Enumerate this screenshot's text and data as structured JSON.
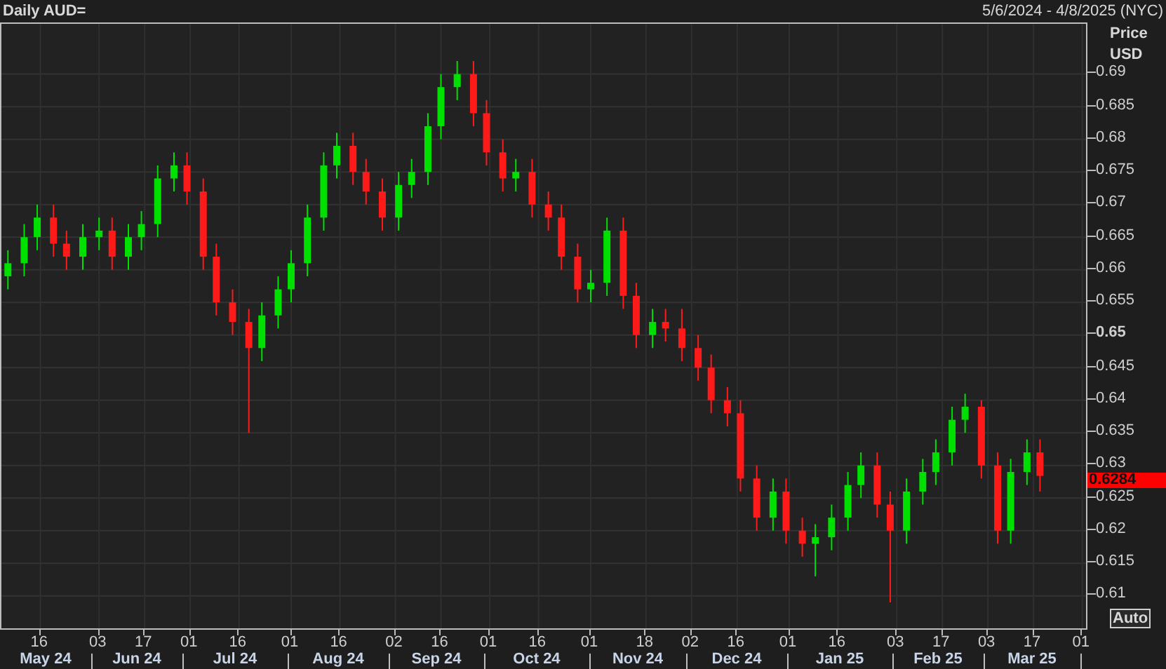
{
  "header": {
    "title": "Daily AUD=",
    "range": "5/6/2024 - 4/8/2025 (NYC)"
  },
  "price_axis": {
    "title": "Price",
    "unit": "USD"
  },
  "last_price": "0.6284",
  "auto_button": "Auto",
  "time_axis": {
    "months": [
      "May 24",
      "Jun 24",
      "Jul 24",
      "Aug 24",
      "Sep 24",
      "Oct 24",
      "Nov 24",
      "Dec 24",
      "Jan 25",
      "Feb 25",
      "Mar 25"
    ]
  },
  "chart": {
    "chart_data": {
      "type": "candlestick",
      "xlim": [
        "2024-05-04",
        "2025-04-03"
      ],
      "ylim": [
        0.6046,
        0.6977
      ],
      "grid": true,
      "x": [
        "2024-05-06",
        "2024-05-11",
        "2024-05-15",
        "2024-05-20",
        "2024-05-24",
        "2024-05-29",
        "2024-06-03",
        "2024-06-07",
        "2024-06-12",
        "2024-06-16",
        "2024-06-21",
        "2024-06-26",
        "2024-06-30",
        "2024-07-05",
        "2024-07-09",
        "2024-07-14",
        "2024-07-19",
        "2024-07-23",
        "2024-07-28",
        "2024-08-01",
        "2024-08-06",
        "2024-08-11",
        "2024-08-15",
        "2024-08-20",
        "2024-08-24",
        "2024-08-29",
        "2024-09-03",
        "2024-09-07",
        "2024-09-12",
        "2024-09-16",
        "2024-09-21",
        "2024-09-26",
        "2024-09-30",
        "2024-10-05",
        "2024-10-09",
        "2024-10-14",
        "2024-10-19",
        "2024-10-23",
        "2024-10-28",
        "2024-11-01",
        "2024-11-06",
        "2024-11-11",
        "2024-11-15",
        "2024-11-20",
        "2024-11-24",
        "2024-11-29",
        "2024-12-04",
        "2024-12-08",
        "2024-12-13",
        "2024-12-17",
        "2024-12-22",
        "2024-12-27",
        "2024-12-31",
        "2025-01-05",
        "2025-01-09",
        "2025-01-14",
        "2025-01-19",
        "2025-01-23",
        "2025-01-28",
        "2025-02-01",
        "2025-02-06",
        "2025-02-11",
        "2025-02-15",
        "2025-02-20",
        "2025-02-24",
        "2025-03-01",
        "2025-03-06",
        "2025-03-10",
        "2025-03-15",
        "2025-03-19"
      ],
      "xticks": [
        {
          "value": "2024-05-16",
          "label": "16"
        },
        {
          "value": "2024-06-03",
          "label": "03"
        },
        {
          "value": "2024-06-17",
          "label": "17"
        },
        {
          "value": "2024-07-01",
          "label": "01"
        },
        {
          "value": "2024-07-16",
          "label": "16"
        },
        {
          "value": "2024-08-01",
          "label": "01"
        },
        {
          "value": "2024-08-16",
          "label": "16"
        },
        {
          "value": "2024-09-02",
          "label": "02"
        },
        {
          "value": "2024-09-16",
          "label": "16"
        },
        {
          "value": "2024-10-01",
          "label": "01"
        },
        {
          "value": "2024-10-16",
          "label": "16"
        },
        {
          "value": "2024-11-01",
          "label": "01"
        },
        {
          "value": "2024-11-18",
          "label": "18"
        },
        {
          "value": "2024-12-02",
          "label": "02"
        },
        {
          "value": "2024-12-16",
          "label": "16"
        },
        {
          "value": "2025-01-01",
          "label": "01"
        },
        {
          "value": "2025-01-16",
          "label": "16"
        },
        {
          "value": "2025-02-03",
          "label": "03"
        },
        {
          "value": "2025-02-17",
          "label": "17"
        },
        {
          "value": "2025-03-03",
          "label": "03"
        },
        {
          "value": "2025-03-17",
          "label": "17"
        },
        {
          "value": "2025-04-01",
          "label": "01"
        }
      ],
      "yticks": [
        {
          "value": 0.69,
          "label": "0.69"
        },
        {
          "value": 0.685,
          "label": "0.685"
        },
        {
          "value": 0.68,
          "label": "0.68"
        },
        {
          "value": 0.675,
          "label": "0.675"
        },
        {
          "value": 0.67,
          "label": "0.67"
        },
        {
          "value": 0.665,
          "label": "0.665"
        },
        {
          "value": 0.66,
          "label": "0.66"
        },
        {
          "value": 0.655,
          "label": "0.655"
        },
        {
          "value": 0.65,
          "label": "0.65"
        },
        {
          "value": 0.645,
          "label": "0.645"
        },
        {
          "value": 0.64,
          "label": "0.64"
        },
        {
          "value": 0.635,
          "label": "0.635"
        },
        {
          "value": 0.63,
          "label": "0.63"
        },
        {
          "value": 0.625,
          "label": "0.625"
        },
        {
          "value": 0.62,
          "label": "0.62"
        },
        {
          "value": 0.615,
          "label": "0.615"
        },
        {
          "value": 0.61,
          "label": "0.61"
        }
      ],
      "ohlc": [
        [
          0.659,
          0.663,
          0.657,
          0.661
        ],
        [
          0.661,
          0.667,
          0.659,
          0.665
        ],
        [
          0.665,
          0.67,
          0.663,
          0.668
        ],
        [
          0.668,
          0.67,
          0.662,
          0.664
        ],
        [
          0.664,
          0.666,
          0.66,
          0.662
        ],
        [
          0.662,
          0.667,
          0.66,
          0.665
        ],
        [
          0.665,
          0.668,
          0.663,
          0.666
        ],
        [
          0.666,
          0.668,
          0.66,
          0.662
        ],
        [
          0.662,
          0.667,
          0.66,
          0.665
        ],
        [
          0.665,
          0.669,
          0.663,
          0.667
        ],
        [
          0.667,
          0.676,
          0.665,
          0.674
        ],
        [
          0.674,
          0.678,
          0.672,
          0.676
        ],
        [
          0.676,
          0.678,
          0.67,
          0.672
        ],
        [
          0.672,
          0.674,
          0.66,
          0.662
        ],
        [
          0.662,
          0.664,
          0.653,
          0.655
        ],
        [
          0.655,
          0.657,
          0.65,
          0.652
        ],
        [
          0.652,
          0.654,
          0.635,
          0.648
        ],
        [
          0.648,
          0.655,
          0.646,
          0.653
        ],
        [
          0.653,
          0.659,
          0.651,
          0.657
        ],
        [
          0.657,
          0.663,
          0.655,
          0.661
        ],
        [
          0.661,
          0.67,
          0.659,
          0.668
        ],
        [
          0.668,
          0.678,
          0.666,
          0.676
        ],
        [
          0.676,
          0.681,
          0.674,
          0.679
        ],
        [
          0.679,
          0.681,
          0.673,
          0.675
        ],
        [
          0.675,
          0.677,
          0.67,
          0.672
        ],
        [
          0.672,
          0.674,
          0.666,
          0.668
        ],
        [
          0.668,
          0.675,
          0.666,
          0.673
        ],
        [
          0.673,
          0.677,
          0.671,
          0.675
        ],
        [
          0.675,
          0.684,
          0.673,
          0.682
        ],
        [
          0.682,
          0.69,
          0.68,
          0.688
        ],
        [
          0.688,
          0.692,
          0.686,
          0.69
        ],
        [
          0.69,
          0.692,
          0.682,
          0.684
        ],
        [
          0.684,
          0.686,
          0.676,
          0.678
        ],
        [
          0.678,
          0.68,
          0.672,
          0.674
        ],
        [
          0.674,
          0.677,
          0.672,
          0.675
        ],
        [
          0.675,
          0.677,
          0.668,
          0.67
        ],
        [
          0.67,
          0.672,
          0.666,
          0.668
        ],
        [
          0.668,
          0.67,
          0.66,
          0.662
        ],
        [
          0.662,
          0.664,
          0.655,
          0.657
        ],
        [
          0.657,
          0.66,
          0.655,
          0.658
        ],
        [
          0.658,
          0.668,
          0.656,
          0.666
        ],
        [
          0.666,
          0.668,
          0.654,
          0.656
        ],
        [
          0.656,
          0.658,
          0.648,
          0.65
        ],
        [
          0.65,
          0.654,
          0.648,
          0.652
        ],
        [
          0.652,
          0.654,
          0.649,
          0.651
        ],
        [
          0.651,
          0.654,
          0.646,
          0.648
        ],
        [
          0.648,
          0.65,
          0.643,
          0.645
        ],
        [
          0.645,
          0.647,
          0.638,
          0.64
        ],
        [
          0.64,
          0.642,
          0.636,
          0.638
        ],
        [
          0.638,
          0.64,
          0.626,
          0.628
        ],
        [
          0.628,
          0.63,
          0.62,
          0.622
        ],
        [
          0.622,
          0.628,
          0.62,
          0.626
        ],
        [
          0.626,
          0.628,
          0.618,
          0.62
        ],
        [
          0.62,
          0.622,
          0.616,
          0.618
        ],
        [
          0.618,
          0.621,
          0.613,
          0.619
        ],
        [
          0.619,
          0.624,
          0.617,
          0.622
        ],
        [
          0.622,
          0.629,
          0.62,
          0.627
        ],
        [
          0.627,
          0.632,
          0.625,
          0.63
        ],
        [
          0.63,
          0.632,
          0.622,
          0.624
        ],
        [
          0.624,
          0.626,
          0.609,
          0.62
        ],
        [
          0.62,
          0.628,
          0.618,
          0.626
        ],
        [
          0.626,
          0.631,
          0.624,
          0.629
        ],
        [
          0.629,
          0.634,
          0.627,
          0.632
        ],
        [
          0.632,
          0.639,
          0.63,
          0.637
        ],
        [
          0.637,
          0.641,
          0.635,
          0.639
        ],
        [
          0.639,
          0.64,
          0.628,
          0.63
        ],
        [
          0.63,
          0.632,
          0.618,
          0.62
        ],
        [
          0.62,
          0.631,
          0.618,
          0.629
        ],
        [
          0.629,
          0.634,
          0.627,
          0.632
        ],
        [
          0.632,
          0.634,
          0.626,
          0.6284
        ]
      ]
    }
  }
}
